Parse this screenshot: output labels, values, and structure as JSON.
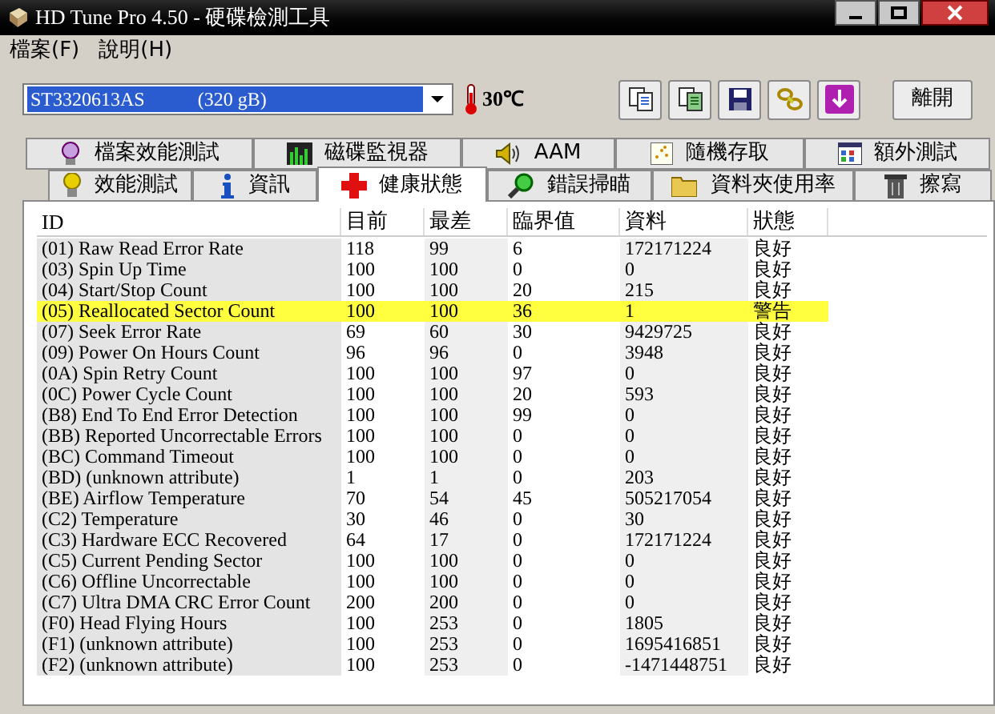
{
  "window": {
    "title": "HD Tune Pro 4.50 - 硬碟檢測工具"
  },
  "menu": [
    "檔案(F)",
    "說明(H)"
  ],
  "toolbar": {
    "drive": "ST3320613AS           (320 gB)",
    "temperature": "30℃",
    "tools": [
      {
        "kind": "copy"
      },
      {
        "kind": "copy-green"
      },
      {
        "kind": "save"
      },
      {
        "kind": "options"
      },
      {
        "kind": "download"
      }
    ],
    "exit": "離開"
  },
  "tabs_top": [
    {
      "label": "檔案效能測試",
      "kind": "file",
      "selected": false
    },
    {
      "label": "磁碟監視器",
      "kind": "monitor",
      "selected": false
    },
    {
      "label": "AAM",
      "kind": "speaker",
      "selected": false
    },
    {
      "label": "隨機存取",
      "kind": "random",
      "selected": false
    },
    {
      "label": "額外測試",
      "kind": "extra",
      "selected": false
    }
  ],
  "tabs_bottom": [
    {
      "label": "效能測試",
      "kind": "bulb",
      "selected": false
    },
    {
      "label": "資訊",
      "kind": "info",
      "selected": false
    },
    {
      "label": "健康狀態",
      "kind": "health",
      "selected": true
    },
    {
      "label": "錯誤掃瞄",
      "kind": "scan",
      "selected": false
    },
    {
      "label": "資料夾使用率",
      "kind": "folder",
      "selected": false
    },
    {
      "label": "擦寫",
      "kind": "trash",
      "selected": false
    }
  ],
  "table": {
    "columns": [
      "ID",
      "目前",
      "最差",
      "臨界值",
      "資料",
      "狀態"
    ],
    "rows": [
      {
        "cells": [
          "(01) Raw Read Error Rate",
          "118",
          "99",
          "6",
          "172171224",
          "良好"
        ],
        "warning": false
      },
      {
        "cells": [
          "(03) Spin Up Time",
          "100",
          "100",
          "0",
          "0",
          "良好"
        ],
        "warning": false
      },
      {
        "cells": [
          "(04) Start/Stop Count",
          "100",
          "100",
          "20",
          "215",
          "良好"
        ],
        "warning": false
      },
      {
        "cells": [
          "(05) Reallocated Sector Count",
          "100",
          "100",
          "36",
          "1",
          "警告"
        ],
        "warning": true
      },
      {
        "cells": [
          "(07) Seek Error Rate",
          "69",
          "60",
          "30",
          "9429725",
          "良好"
        ],
        "warning": false
      },
      {
        "cells": [
          "(09) Power On Hours Count",
          "96",
          "96",
          "0",
          "3948",
          "良好"
        ],
        "warning": false
      },
      {
        "cells": [
          "(0A) Spin Retry Count",
          "100",
          "100",
          "97",
          "0",
          "良好"
        ],
        "warning": false
      },
      {
        "cells": [
          "(0C) Power Cycle Count",
          "100",
          "100",
          "20",
          "593",
          "良好"
        ],
        "warning": false
      },
      {
        "cells": [
          "(B8) End To End Error Detection",
          "100",
          "100",
          "99",
          "0",
          "良好"
        ],
        "warning": false
      },
      {
        "cells": [
          "(BB) Reported Uncorrectable Errors",
          "100",
          "100",
          "0",
          "0",
          "良好"
        ],
        "warning": false
      },
      {
        "cells": [
          "(BC) Command Timeout",
          "100",
          "100",
          "0",
          "0",
          "良好"
        ],
        "warning": false
      },
      {
        "cells": [
          "(BD) (unknown attribute)",
          "1",
          "1",
          "0",
          "203",
          "良好"
        ],
        "warning": false
      },
      {
        "cells": [
          "(BE) Airflow Temperature",
          "70",
          "54",
          "45",
          "505217054",
          "良好"
        ],
        "warning": false
      },
      {
        "cells": [
          "(C2) Temperature",
          "30",
          "46",
          "0",
          "30",
          "良好"
        ],
        "warning": false
      },
      {
        "cells": [
          "(C3) Hardware ECC Recovered",
          "64",
          "17",
          "0",
          "172171224",
          "良好"
        ],
        "warning": false
      },
      {
        "cells": [
          "(C5) Current Pending Sector",
          "100",
          "100",
          "0",
          "0",
          "良好"
        ],
        "warning": false
      },
      {
        "cells": [
          "(C6) Offline Uncorrectable",
          "100",
          "100",
          "0",
          "0",
          "良好"
        ],
        "warning": false
      },
      {
        "cells": [
          "(C7) Ultra DMA CRC Error Count",
          "200",
          "200",
          "0",
          "0",
          "良好"
        ],
        "warning": false
      },
      {
        "cells": [
          "(F0) Head Flying Hours",
          "100",
          "253",
          "0",
          "1805",
          "良好"
        ],
        "warning": false
      },
      {
        "cells": [
          "(F1) (unknown attribute)",
          "100",
          "253",
          "0",
          "1695416851",
          "良好"
        ],
        "warning": false
      },
      {
        "cells": [
          "(F2) (unknown attribute)",
          "100",
          "253",
          "0",
          "-1471448751",
          "良好"
        ],
        "warning": false
      }
    ]
  }
}
